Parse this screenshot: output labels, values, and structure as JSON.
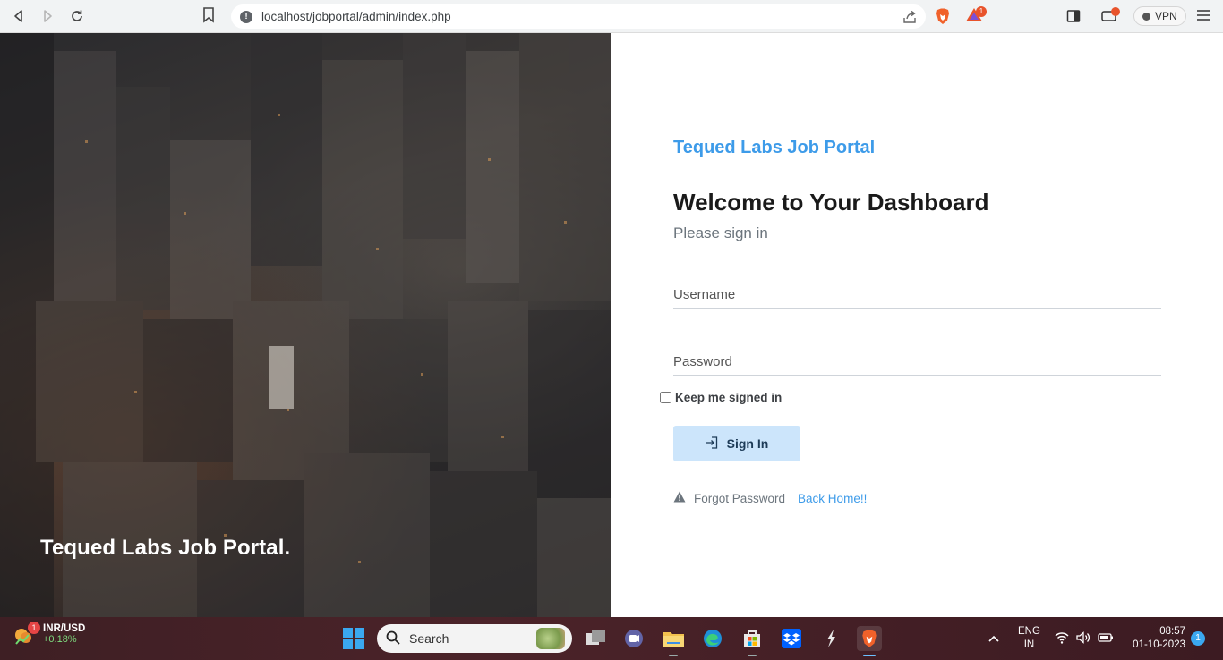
{
  "browser": {
    "url": "localhost/jobportal/admin/index.php",
    "vpn_label": "VPN",
    "rewards_badge": "1"
  },
  "hero": {
    "caption": "Tequed Labs Job Portal."
  },
  "login": {
    "brand": "Tequed Labs Job Portal",
    "heading": "Welcome to Your Dashboard",
    "subtitle": "Please sign in",
    "username_placeholder": "Username",
    "password_placeholder": "Password",
    "keep_signed_in": "Keep me signed in",
    "signin_label": "Sign In",
    "forgot_label": "Forgot Password",
    "back_label": "Back Home!!",
    "accent_color": "#3d9be9"
  },
  "taskbar": {
    "widget_title": "INR/USD",
    "widget_change": "+0.18%",
    "widget_badge": "1",
    "search_label": "Search",
    "lang_line1": "ENG",
    "lang_line2": "IN",
    "time": "08:57",
    "date": "01-10-2023",
    "notification_count": "1"
  }
}
